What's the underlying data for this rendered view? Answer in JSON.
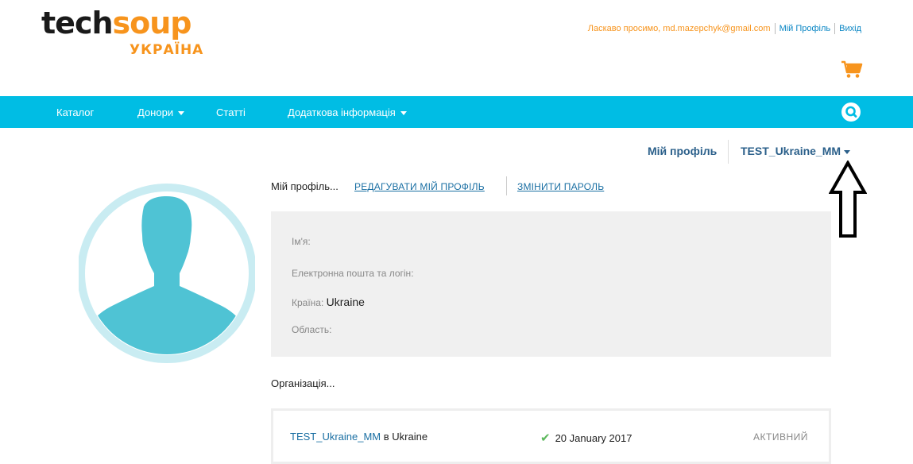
{
  "brand": {
    "logo_text_a": "tech",
    "logo_text_b": "soup",
    "logo_sub": "УКРАЇНА",
    "accent_color": "#f7941d",
    "nav_color": "#00bde4"
  },
  "top_links": {
    "welcome": "Ласкаво просимо, md.mazepchyk@gmail.com",
    "my_profile": "Мій Профіль",
    "logout": "Вихід"
  },
  "nav": {
    "items": [
      {
        "label": "Каталог",
        "dropdown": false
      },
      {
        "label": "Донори",
        "dropdown": true
      },
      {
        "label": "Статті",
        "dropdown": false
      },
      {
        "label": "Додаткова інформація",
        "dropdown": true
      }
    ],
    "search_icon": "search-icon"
  },
  "profile_header": {
    "my_profile": "Мій профіль",
    "username": "TEST_Ukraine_MM"
  },
  "profile": {
    "title": "Мій профіль...",
    "edit_link": "РЕДАГУВАТИ МІЙ ПРОФІЛЬ",
    "change_password_link": "ЗМІНИТИ ПАРОЛЬ",
    "fields": {
      "name_label": "Ім'я:",
      "email_label": "Електронна пошта та логін:",
      "country_label": "Країна:",
      "country_value": "Ukraine",
      "region_label": "Область:"
    }
  },
  "organization": {
    "title": "Організація...",
    "name": "TEST_Ukraine_MM",
    "in_country": "в Ukraine",
    "date": "20 January 2017",
    "status": "АКТИВНИЙ"
  }
}
